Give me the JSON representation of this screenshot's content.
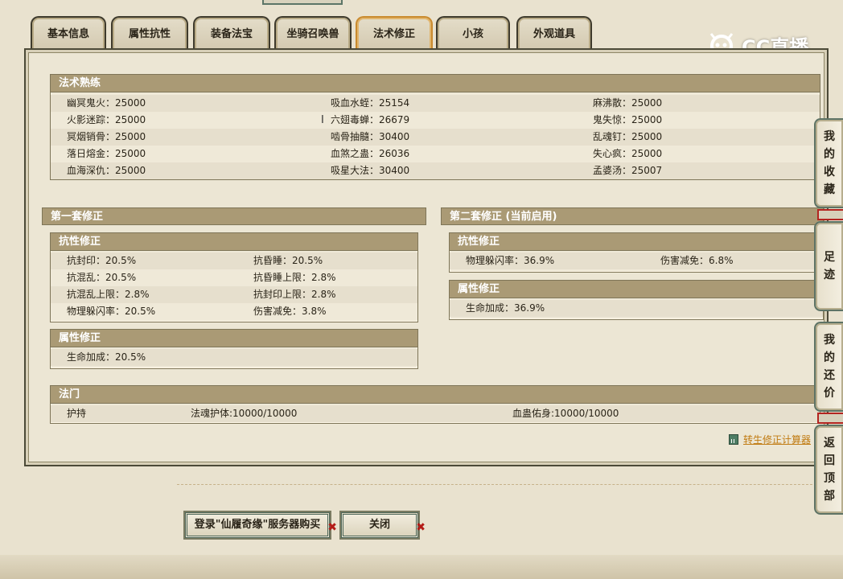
{
  "tabs": [
    {
      "label": "基本信息",
      "active": false
    },
    {
      "label": "属性抗性",
      "active": false
    },
    {
      "label": "装备法宝",
      "active": false
    },
    {
      "label": "坐骑召唤兽",
      "active": false
    },
    {
      "label": "法术修正",
      "active": true
    },
    {
      "label": "小孩",
      "active": false
    },
    {
      "label": "外观道具",
      "active": false
    }
  ],
  "logo": {
    "text": "CC直播"
  },
  "spell_mastery": {
    "title": "法术熟练",
    "rows": [
      [
        "幽冥鬼火：25000",
        "吸血水蛭：25154",
        "麻沸散：25000"
      ],
      [
        "火影迷踪：25000",
        "六翅毒蝉：26679",
        "鬼失惊：25000"
      ],
      [
        "冥烟销骨：25000",
        "啮骨抽髓：30400",
        "乱魂钉：25000"
      ],
      [
        "落日熔金：25000",
        "血煞之蛊：26036",
        "失心疯：25000"
      ],
      [
        "血海深仇：25000",
        "吸星大法：30400",
        "孟婆汤：25007"
      ]
    ]
  },
  "set1": {
    "title": "第一套修正",
    "resist": {
      "title": "抗性修正",
      "rows": [
        [
          "抗封印：20.5%",
          "抗昏睡：20.5%"
        ],
        [
          "抗混乱：20.5%",
          "抗昏睡上限：2.8%"
        ],
        [
          "抗混乱上限：2.8%",
          "抗封印上限：2.8%"
        ],
        [
          "物理躲闪率：20.5%",
          "伤害减免：3.8%"
        ]
      ]
    },
    "attr": {
      "title": "属性修正",
      "rows": [
        [
          "生命加成：20.5%"
        ]
      ]
    }
  },
  "set2": {
    "title": "第二套修正 (当前启用)",
    "resist": {
      "title": "抗性修正",
      "rows": [
        [
          "物理躲闪率：36.9%",
          "伤害减免：6.8%"
        ]
      ]
    },
    "attr": {
      "title": "属性修正",
      "rows": [
        [
          "生命加成：36.9%"
        ]
      ]
    }
  },
  "school": {
    "title": "法门",
    "row": [
      "护持",
      "法魂护体:10000/10000",
      "血蛊佑身:10000/10000"
    ]
  },
  "calc_link": "转生修正计算器",
  "buttons": {
    "login": "登录\"仙履奇缘\"服务器购买",
    "close": "关闭"
  },
  "sidebar": [
    {
      "label": "我的收藏",
      "chars": [
        "我",
        "的",
        "收",
        "藏"
      ]
    },
    {
      "label": "足迹",
      "chars": [
        "足",
        "迹"
      ]
    },
    {
      "label": "我的还价",
      "chars": [
        "我",
        "的",
        "还",
        "价"
      ]
    },
    {
      "label": "返回顶部",
      "chars": [
        "返",
        "回",
        "顶",
        "部"
      ]
    }
  ]
}
